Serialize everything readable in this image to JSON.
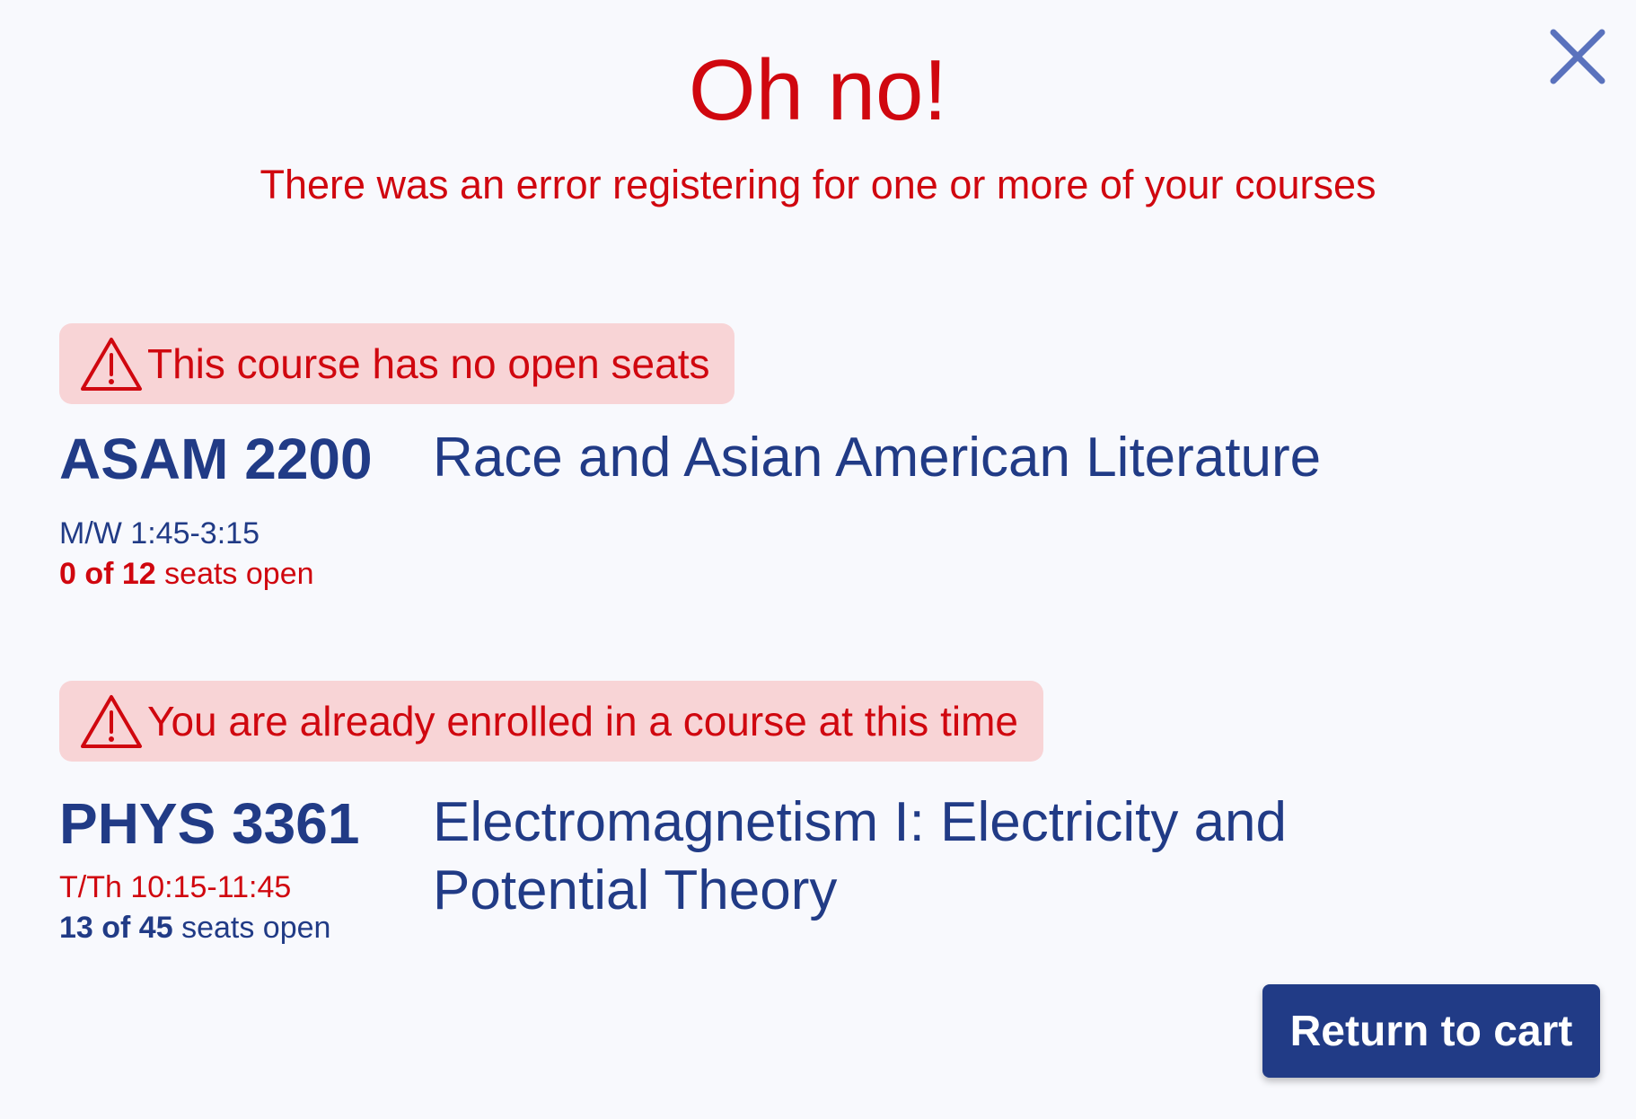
{
  "dialog": {
    "title": "Oh no!",
    "subtitle": "There was an error registering for one or more of your courses",
    "close_icon": "close-icon"
  },
  "errors": [
    {
      "alert_icon": "warning-icon",
      "message": "This course has no open seats",
      "course": {
        "code": "ASAM 2200",
        "name": "Race and Asian American Literature",
        "schedule": "M/W 1:45-3:15",
        "seats_open": "0 of 12",
        "seats_suffix": " seats open"
      }
    },
    {
      "alert_icon": "warning-icon",
      "message": "You are already enrolled in a course at this time",
      "course": {
        "code": "PHYS 3361",
        "name": "Electromagnetism I: Electricity and Potential Theory",
        "schedule": "T/Th 10:15-11:45",
        "seats_open": "13 of 45",
        "seats_suffix": " seats open"
      }
    }
  ],
  "actions": {
    "return_label": "Return to cart"
  },
  "colors": {
    "error": "#d0070f",
    "error_bg": "#f8d4d6",
    "primary": "#213b86",
    "close": "#5a72bd",
    "background": "#f8f9fd"
  }
}
